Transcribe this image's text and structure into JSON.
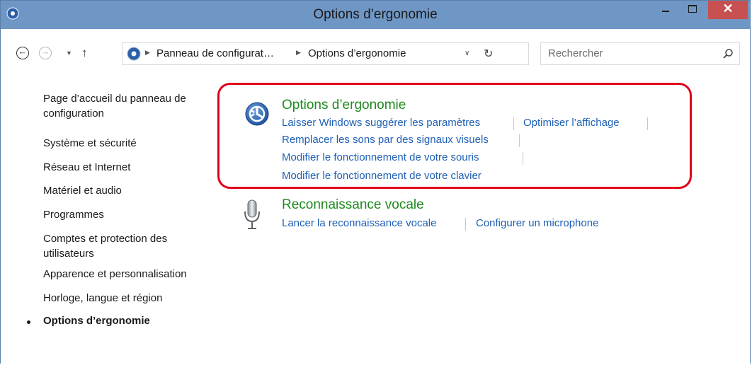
{
  "window": {
    "title": "Options d’ergonomie",
    "minimize": "—",
    "maximize": "□",
    "close": "✕"
  },
  "nav": {
    "back_glyph": "←",
    "forward_glyph": "→",
    "recent_glyph": "▼",
    "up_glyph": "↑"
  },
  "address": {
    "crumbs": [
      "Panneau de configurat…",
      "Options d’ergonomie"
    ],
    "arrow_glyph": "▶",
    "dropdown_glyph": "∨",
    "refresh_glyph": "↻"
  },
  "search": {
    "placeholder": "Rechercher",
    "icon": "search-icon"
  },
  "sidebar": {
    "items": [
      {
        "label": "Page d’accueil du panneau de configuration"
      },
      {
        "label": "Système et sécurité"
      },
      {
        "label": "Réseau et Internet"
      },
      {
        "label": "Matériel et audio"
      },
      {
        "label": "Programmes"
      },
      {
        "label": "Comptes et protection des utilisateurs"
      },
      {
        "label": "Apparence et personnalisation"
      },
      {
        "label": "Horloge, langue et région"
      }
    ],
    "current": "Options d’ergonomie"
  },
  "categories": [
    {
      "title": "Options d’ergonomie",
      "icon": "ease-of-access-icon",
      "links": [
        "Laisser Windows suggérer les paramètres",
        "Optimiser l’affichage",
        "Remplacer les sons par des signaux visuels",
        "Modifier le fonctionnement de votre souris",
        "Modifier le fonctionnement de votre clavier"
      ]
    },
    {
      "title": "Reconnaissance vocale",
      "icon": "microphone-icon",
      "links": [
        "Lancer la reconnaissance vocale",
        "Configurer un microphone"
      ]
    }
  ],
  "colors": {
    "titlebar": "#6f97c6",
    "category_title": "#1e8a1e",
    "link": "#1e5fb4",
    "highlight": "#e0001a",
    "close_button": "#c75050"
  }
}
